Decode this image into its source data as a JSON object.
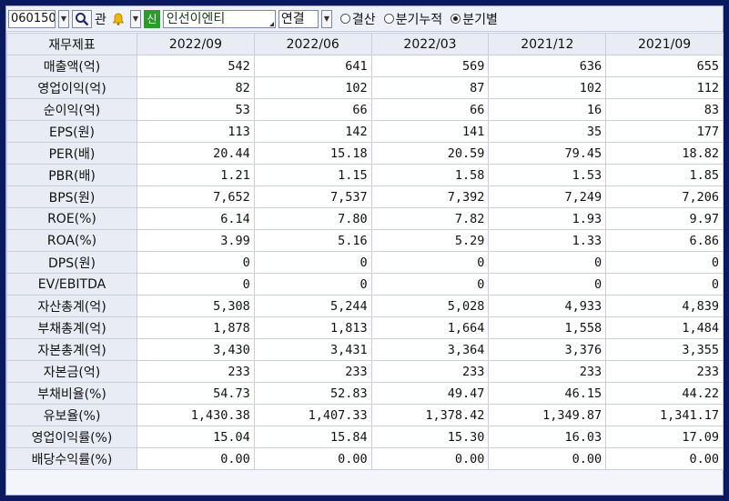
{
  "toolbar": {
    "code_value": "060150",
    "label_gwan": "관",
    "badge_shin": "신",
    "company_name": "인선이엔티",
    "select_value": "연결",
    "radios": [
      {
        "label": "결산",
        "selected": false
      },
      {
        "label": "분기누적",
        "selected": false
      },
      {
        "label": "분기별",
        "selected": true
      }
    ]
  },
  "table": {
    "headers": [
      "재무제표",
      "2022/09",
      "2022/06",
      "2022/03",
      "2021/12",
      "2021/09"
    ],
    "rows": [
      {
        "label": "매출액(억)",
        "values": [
          "542",
          "641",
          "569",
          "636",
          "655"
        ]
      },
      {
        "label": "영업이익(억)",
        "values": [
          "82",
          "102",
          "87",
          "102",
          "112"
        ]
      },
      {
        "label": "순이익(억)",
        "values": [
          "53",
          "66",
          "66",
          "16",
          "83"
        ]
      },
      {
        "label": "EPS(원)",
        "values": [
          "113",
          "142",
          "141",
          "35",
          "177"
        ]
      },
      {
        "label": "PER(배)",
        "values": [
          "20.44",
          "15.18",
          "20.59",
          "79.45",
          "18.82"
        ]
      },
      {
        "label": "PBR(배)",
        "values": [
          "1.21",
          "1.15",
          "1.58",
          "1.53",
          "1.85"
        ]
      },
      {
        "label": "BPS(원)",
        "values": [
          "7,652",
          "7,537",
          "7,392",
          "7,249",
          "7,206"
        ]
      },
      {
        "label": "ROE(%)",
        "values": [
          "6.14",
          "7.80",
          "7.82",
          "1.93",
          "9.97"
        ]
      },
      {
        "label": "ROA(%)",
        "values": [
          "3.99",
          "5.16",
          "5.29",
          "1.33",
          "6.86"
        ]
      },
      {
        "label": "DPS(원)",
        "values": [
          "0",
          "0",
          "0",
          "0",
          "0"
        ]
      },
      {
        "label": "EV/EBITDA",
        "values": [
          "0",
          "0",
          "0",
          "0",
          "0"
        ]
      },
      {
        "label": "자산총계(억)",
        "values": [
          "5,308",
          "5,244",
          "5,028",
          "4,933",
          "4,839"
        ]
      },
      {
        "label": "부채총계(억)",
        "values": [
          "1,878",
          "1,813",
          "1,664",
          "1,558",
          "1,484"
        ]
      },
      {
        "label": "자본총계(억)",
        "values": [
          "3,430",
          "3,431",
          "3,364",
          "3,376",
          "3,355"
        ]
      },
      {
        "label": "자본금(억)",
        "values": [
          "233",
          "233",
          "233",
          "233",
          "233"
        ]
      },
      {
        "label": "부채비율(%)",
        "values": [
          "54.73",
          "52.83",
          "49.47",
          "46.15",
          "44.22"
        ]
      },
      {
        "label": "유보율(%)",
        "values": [
          "1,430.38",
          "1,407.33",
          "1,378.42",
          "1,349.87",
          "1,341.17"
        ]
      },
      {
        "label": "영업이익률(%)",
        "values": [
          "15.04",
          "15.84",
          "15.30",
          "16.03",
          "17.09"
        ]
      },
      {
        "label": "배당수익률(%)",
        "values": [
          "0.00",
          "0.00",
          "0.00",
          "0.00",
          "0.00"
        ]
      }
    ]
  }
}
